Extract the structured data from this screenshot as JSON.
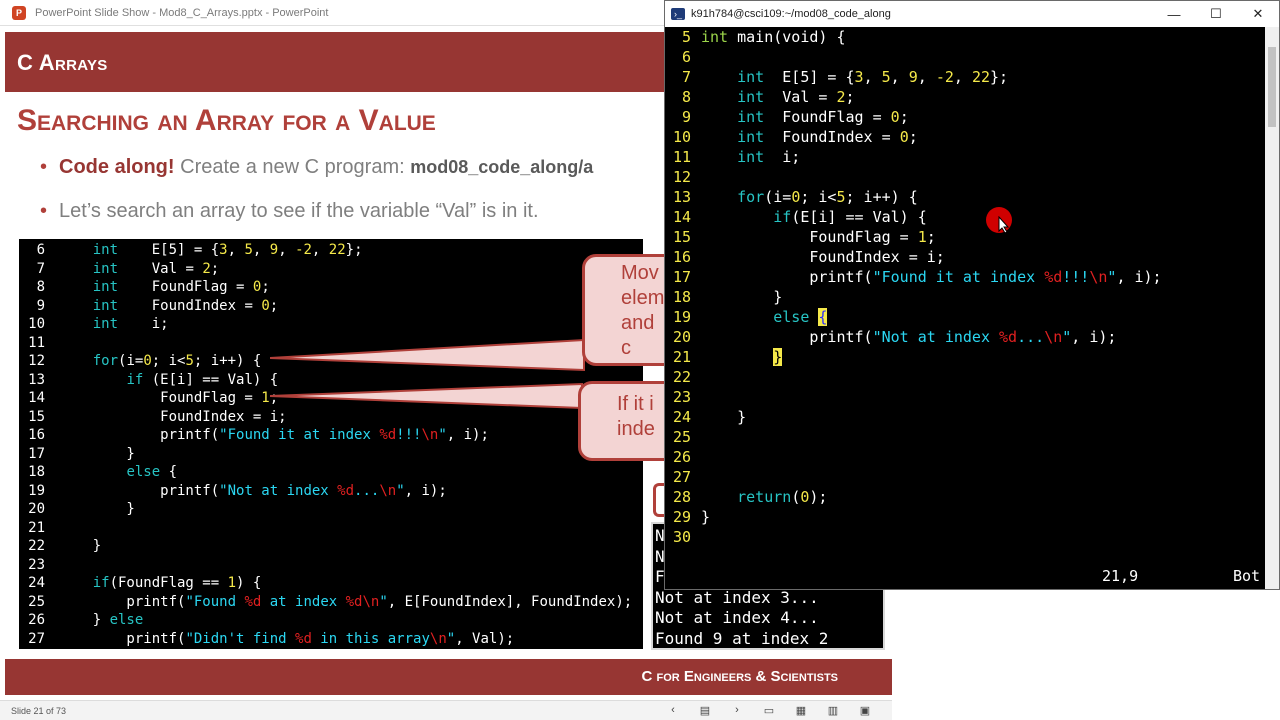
{
  "ppt": {
    "window_title": "PowerPoint Slide Show  -  Mod8_C_Arrays.pptx  -  PowerPoint",
    "logo_letter": "P",
    "header_title": "C Arrays",
    "subtitle": "Searching an Array for a Value",
    "bullet1_strong": "Code along!",
    "bullet1_text": " Create a new C program: ",
    "bullet1_path": "mod08_code_along/a",
    "bullet2_text": "Let’s search an array to see if the variable “Val” is in it.",
    "callout1": [
      "Mov",
      "elem",
      "and",
      "c"
    ],
    "callout2": [
      "If it i",
      "inde"
    ],
    "footer": "C for Engineers & Scientists",
    "slide_status": "Slide 21 of 73",
    "status_icons": [
      "prev-icon",
      "slide-sorter-icon",
      "next-icon",
      "normal-view-icon",
      "grid-view-icon",
      "reading-view-icon",
      "slideshow-icon"
    ],
    "output_lines": [
      "N",
      "N",
      "F",
      "Not at index 3...",
      "Not at index 4...",
      "Found 9 at index 2"
    ]
  },
  "terminal": {
    "title": "k91h784@csci109:~/mod08_code_along",
    "vim_position": "21,9",
    "vim_scroll": "Bot"
  },
  "colors": {
    "slide_red": "#973633",
    "keyword_cyan": "#27c4c4",
    "number_yellow": "#f5e94a",
    "format_red": "#e02020"
  }
}
